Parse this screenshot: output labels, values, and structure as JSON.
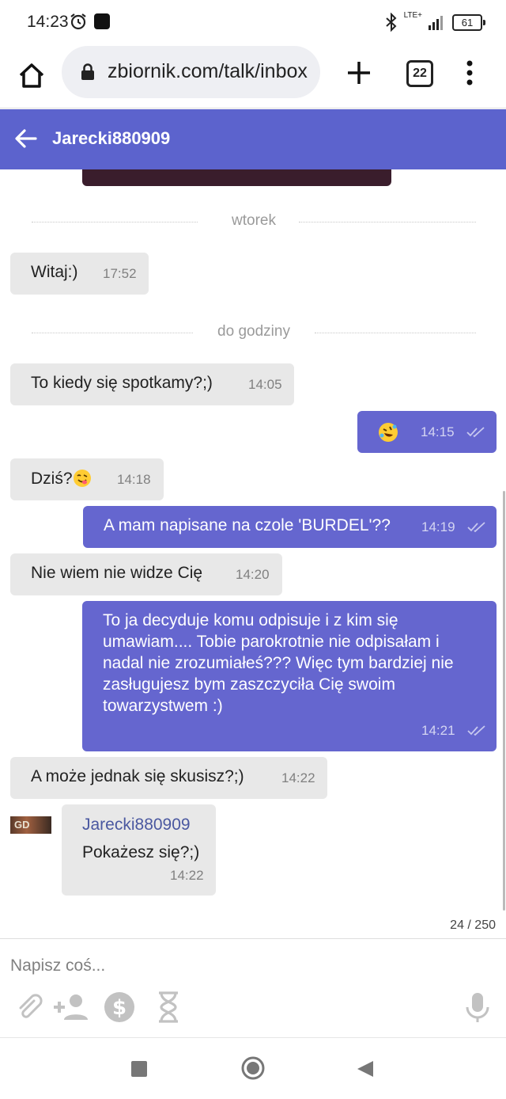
{
  "status_bar": {
    "time": "14:23",
    "network": "LTE+",
    "battery": "61"
  },
  "browser": {
    "url": "zbiornik.com/talk/inbox",
    "tab_count": "22"
  },
  "header": {
    "title": "Jarecki880909"
  },
  "chat": {
    "separators": [
      "wtorek",
      "do godziny"
    ],
    "messages": [
      {
        "text": "Witaj:)",
        "time": "17:52"
      },
      {
        "text": "To kiedy się spotkamy?;)",
        "time": "14:05"
      },
      {
        "text": "",
        "emoji": "rolling-on-floor-laughing",
        "time": "14:15"
      },
      {
        "text": "Dziś?",
        "emoji": "face-savoring-food",
        "time": "14:18"
      },
      {
        "text": "A mam napisane na czole 'BURDEL'??",
        "time": "14:19"
      },
      {
        "text": "Nie wiem nie widze Cię",
        "time": "14:20"
      },
      {
        "text": "To ja decyduje komu odpisuje i z kim się umawiam.... Tobie parokrotnie nie odpisałam i nadal nie zrozumiałeś??? Więc tym bardziej nie zasługujesz bym zaszczyciła Cię swoim towarzystwem :)",
        "time": "14:21"
      },
      {
        "text": "A może jednak się skusisz?;)",
        "time": "14:22"
      },
      {
        "sender": "Jarecki880909",
        "text": "Pokażesz się?;)",
        "time": "14:22"
      }
    ],
    "avatar_text": "GD"
  },
  "composer": {
    "char_count": "24 / 250",
    "placeholder": "Napisz coś..."
  },
  "colors": {
    "accent": "#5c63cd",
    "outgoing_bubble": "#6566cf",
    "incoming_bubble": "#e8e8e8"
  }
}
